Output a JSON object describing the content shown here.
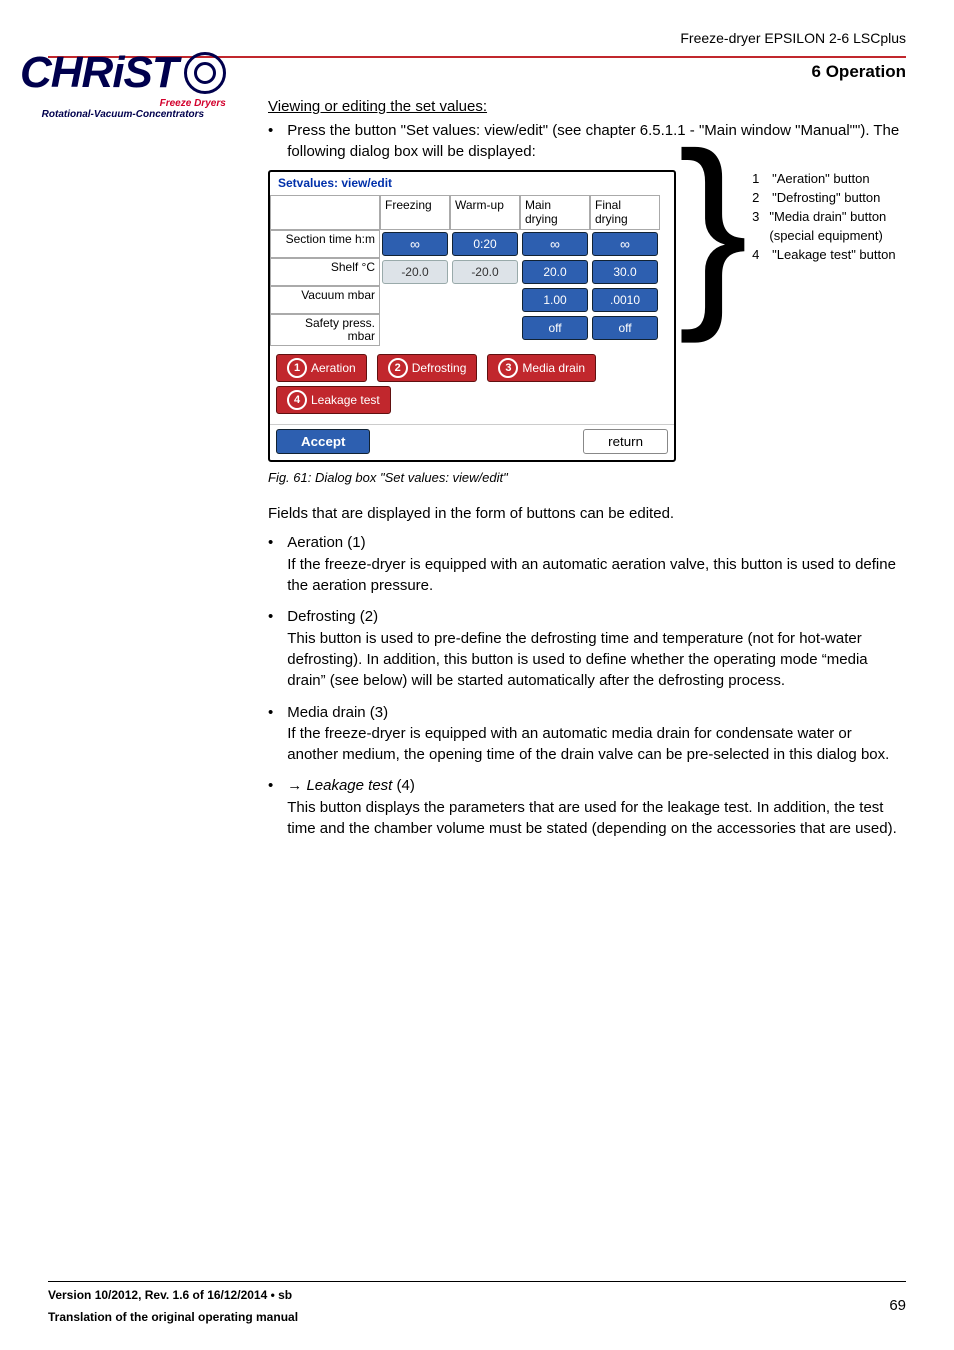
{
  "header": {
    "product": "Freeze-dryer EPSILON 2-6 LSCplus",
    "section": "6 Operation"
  },
  "logo": {
    "main_text": "CHRiST",
    "sub1": "Freeze Dryers",
    "sub2": "Rotational-Vacuum-Concentrators"
  },
  "intro": {
    "heading": "Viewing or editing the set values:",
    "bullet": "Press the button \"Set values: view/edit\" (see chapter 6.5.1.1 - \"Main window \"Manual\"\"). The following dialog box will be displayed:"
  },
  "dialog": {
    "title": "Setvalues: view/edit",
    "cols": {
      "c1": "Freezing",
      "c2": "Warm-up",
      "c3": "Main drying",
      "c4": "Final drying"
    },
    "rows": {
      "section_time": {
        "label": "Section time h:m",
        "v1": "∞",
        "v2": "0:20",
        "v3": "∞",
        "v4": "∞"
      },
      "shelf": {
        "label": "Shelf °C",
        "v1": "-20.0",
        "v2": "-20.0",
        "v3": "20.0",
        "v4": "30.0"
      },
      "vacuum": {
        "label": "Vacuum mbar",
        "v3": "1.00",
        "v4": ".0010"
      },
      "safety": {
        "label": "Safety press. mbar",
        "v3": "off",
        "v4": "off"
      }
    },
    "tabs": {
      "aeration": "Aeration",
      "defrosting": "Defrosting",
      "media": "Media drain",
      "leakage": "Leakage test"
    },
    "badge": {
      "b1": "1",
      "b2": "2",
      "b3": "3",
      "b4": "4"
    },
    "accept": "Accept",
    "return": "return"
  },
  "legend": {
    "i1n": "1",
    "i1t": "\"Aeration\" button",
    "i2n": "2",
    "i2t": "\"Defrosting\" button",
    "i3n": "3",
    "i3t": "\"Media drain\" button (special equipment)",
    "i4n": "4",
    "i4t": "\"Leakage test\" button"
  },
  "figcap": "Fig. 61: Dialog box \"Set values: view/edit\"",
  "para": "Fields that are displayed in the form of buttons can be edited.",
  "items": {
    "a_title": "Aeration (1)",
    "a_body": "If the freeze-dryer is equipped with an automatic aeration valve, this button is used to define the aeration pressure.",
    "d_title": "Defrosting (2)",
    "d_body": "This button is used to pre-define the defrosting time and temperature (not for hot-water defrosting). In addition, this button is used to define whether the operating mode “media drain” (see below) will be started automatically after the defrosting process.",
    "m_title": "Media drain (3)",
    "m_body": "If the freeze-dryer is equipped with an automatic media drain for condensate water or another medium, the opening time of the drain valve can be pre-selected in this dialog box.",
    "l_title_prefix": "→ ",
    "l_title_em": "Leakage test",
    "l_title_suffix": " (4)",
    "l_body": "This button displays the parameters that are used for the leakage test. In addition, the test time and the chamber volume must be stated (depending on the accessories that are used)."
  },
  "footer": {
    "line1": "Version 10/2012, Rev. 1.6 of 16/12/2014 • sb",
    "line2": "Translation of the original operating manual",
    "page": "69"
  }
}
